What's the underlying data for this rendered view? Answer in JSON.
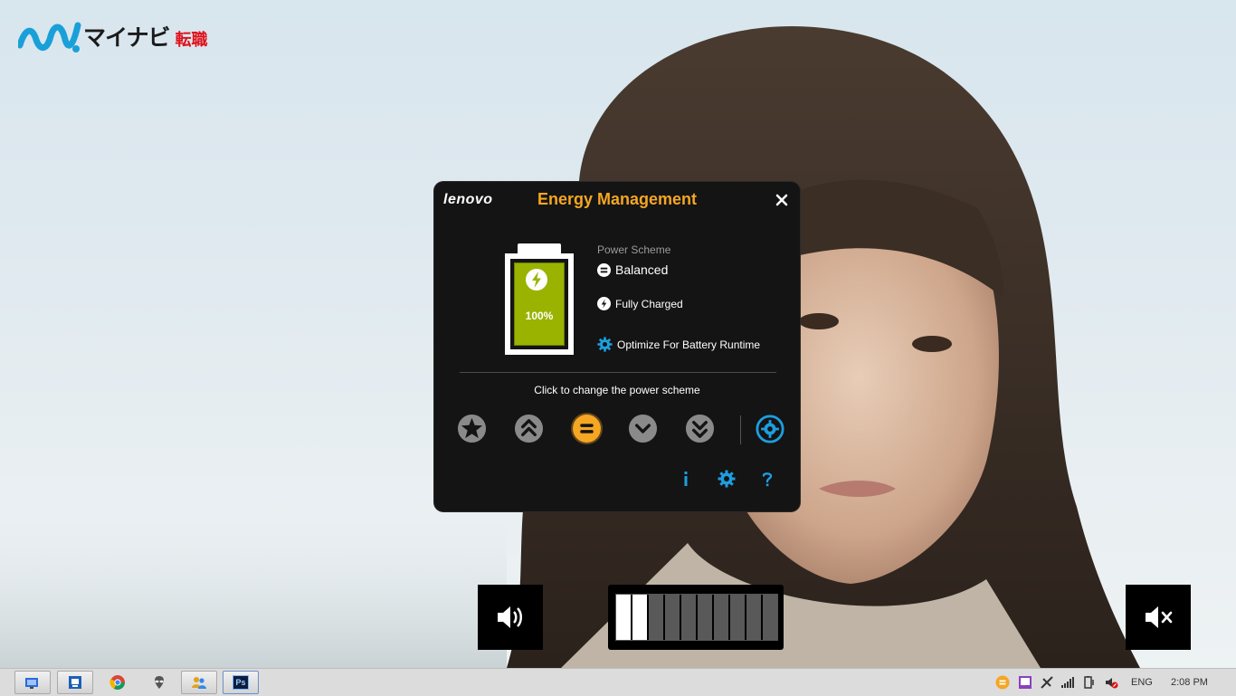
{
  "desktop": {
    "logo_text": "マイナビ",
    "logo_sub": "転職"
  },
  "energy": {
    "brand": "lenovo",
    "title": "Energy Management",
    "battery_percent_label": "100%",
    "battery_level": 1.0,
    "power_scheme_label": "Power Scheme",
    "power_scheme_value": "Balanced",
    "charge_status": "Fully Charged",
    "optimize_link": "Optimize For Battery Runtime",
    "hint": "Click to change the power scheme",
    "schemes": [
      {
        "name": "star",
        "selected": false
      },
      {
        "name": "high-performance",
        "selected": false
      },
      {
        "name": "balanced",
        "selected": true
      },
      {
        "name": "power-saver",
        "selected": false
      },
      {
        "name": "super-saver",
        "selected": false
      }
    ],
    "tools": [
      "info",
      "settings",
      "help"
    ],
    "colors": {
      "accent_orange": "#f5a623",
      "icon_blue": "#1e9ee0",
      "battery_green": "#9ab300",
      "scheme_gray": "#8a8a8a"
    }
  },
  "osd": {
    "brightness_level": 2,
    "brightness_segments": 10,
    "volume_icon": "speaker-icon",
    "mute_icon": "speaker-muted-icon"
  },
  "taskbar": {
    "apps": [
      "desktop-app",
      "remote-app",
      "chrome",
      "alien-app",
      "people-app",
      "photoshop"
    ],
    "photoshop_label": "Ps",
    "language": "ENG",
    "time": "2:08 PM"
  }
}
